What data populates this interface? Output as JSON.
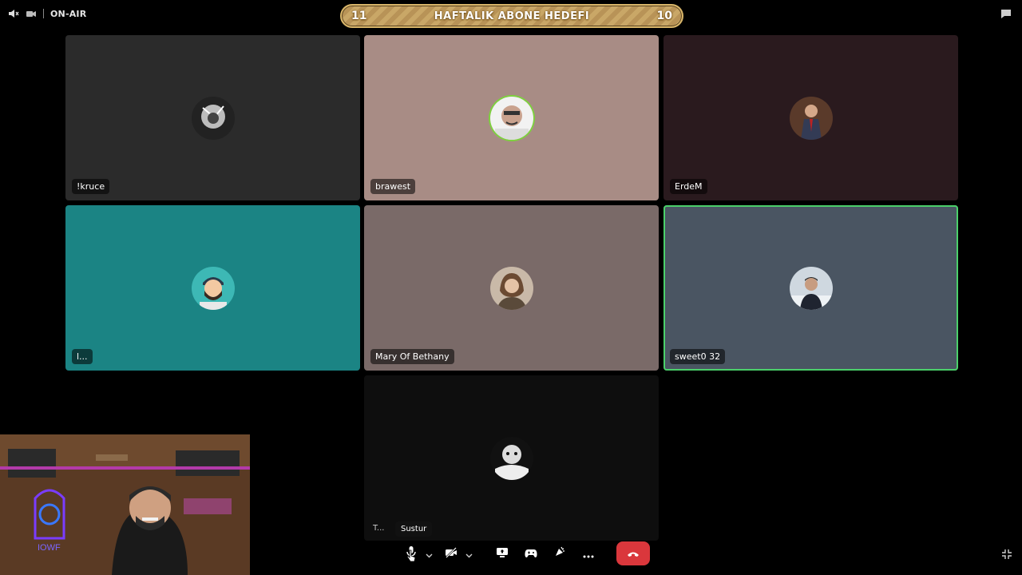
{
  "topbar": {
    "status_label": "ON-AIR",
    "icons": [
      "speaker-muted-icon",
      "camera-icon"
    ]
  },
  "goal_banner": {
    "left_count": "11",
    "title": "HAFTALIK ABONE HEDEFI",
    "right_count": "10"
  },
  "tiles": [
    {
      "name": "!kruce",
      "background": "#2b2b2b",
      "speaking": false
    },
    {
      "name": "brawest",
      "background": "#a88c85",
      "speaking": false
    },
    {
      "name": "ErdeM",
      "background": "#2a1a1e",
      "speaking": false
    },
    {
      "name": "l...",
      "background": "#1b8484",
      "speaking": false
    },
    {
      "name": "Mary Of Bethany",
      "background": "#7a6a68",
      "speaking": false
    },
    {
      "name": "sweet0 32",
      "background": "#4a5562",
      "speaking": true
    },
    {
      "name": "T...",
      "background": "#0e0e0e",
      "speaking": false
    }
  ],
  "controls": {
    "tooltip": "Sustur",
    "icons": [
      "microphone-icon",
      "chevron-down-icon",
      "camera-off-icon",
      "chevron-down-icon",
      "screen-share-icon",
      "activity-icon",
      "soundboard-icon",
      "more-icon",
      "hangup-icon"
    ]
  },
  "colors": {
    "accent_green": "#4bd06a",
    "hangup_red": "#da373c",
    "banner_gold": "#c9a767"
  }
}
